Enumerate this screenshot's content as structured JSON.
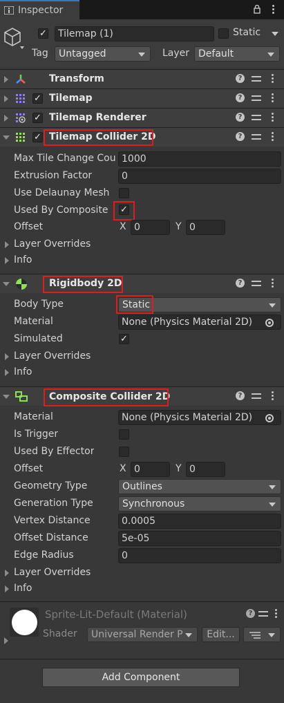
{
  "tab": {
    "title": "Inspector"
  },
  "object": {
    "name": "Tilemap (1)",
    "static_label": "Static",
    "tag_label": "Tag",
    "tag_value": "Untagged",
    "layer_label": "Layer",
    "layer_value": "Default"
  },
  "components": {
    "transform": {
      "title": "Transform"
    },
    "tilemap": {
      "title": "Tilemap"
    },
    "tilemap_renderer": {
      "title": "Tilemap Renderer"
    },
    "tilemap_collider": {
      "title": "Tilemap Collider 2D",
      "max_tile_label": "Max Tile Change Cou",
      "max_tile_value": "1000",
      "extrusion_label": "Extrusion Factor",
      "extrusion_value": "0",
      "delaunay_label": "Use Delaunay Mesh",
      "composite_label": "Used By Composite",
      "composite_check": "✓",
      "offset_label": "Offset",
      "x_label": "X",
      "x_value": "0",
      "y_label": "Y",
      "y_value": "0",
      "layer_overrides": "Layer Overrides",
      "info": "Info"
    },
    "rigidbody": {
      "title": "Rigidbody 2D",
      "body_type_label": "Body Type",
      "body_type_value": "Static",
      "material_label": "Material",
      "material_value": "None (Physics Material 2D)",
      "simulated_label": "Simulated",
      "simulated_check": "✓",
      "layer_overrides": "Layer Overrides",
      "info": "Info"
    },
    "composite_collider": {
      "title": "Composite Collider 2D",
      "material_label": "Material",
      "material_value": "None (Physics Material 2D)",
      "trigger_label": "Is Trigger",
      "effector_label": "Used By Effector",
      "offset_label": "Offset",
      "x_label": "X",
      "x_value": "0",
      "y_label": "Y",
      "y_value": "0",
      "geometry_label": "Geometry Type",
      "geometry_value": "Outlines",
      "generation_label": "Generation Type",
      "generation_value": "Synchronous",
      "vertex_label": "Vertex Distance",
      "vertex_value": "0.0005",
      "offset_distance_label": "Offset Distance",
      "offset_distance_value": "5e-05",
      "edge_radius_label": "Edge Radius",
      "edge_radius_value": "0",
      "layer_overrides": "Layer Overrides",
      "info": "Info"
    },
    "material": {
      "title": "Sprite-Lit-Default (Material)",
      "shader_label": "Shader",
      "shader_value": "Universal Render P",
      "edit_label": "Edit..."
    }
  },
  "footer": {
    "add_component": "Add Component"
  },
  "colors": {
    "highlight": "#e21b1b",
    "background": "#383838",
    "header": "#3e3e3e",
    "tab_accent": "#3a79bb"
  }
}
